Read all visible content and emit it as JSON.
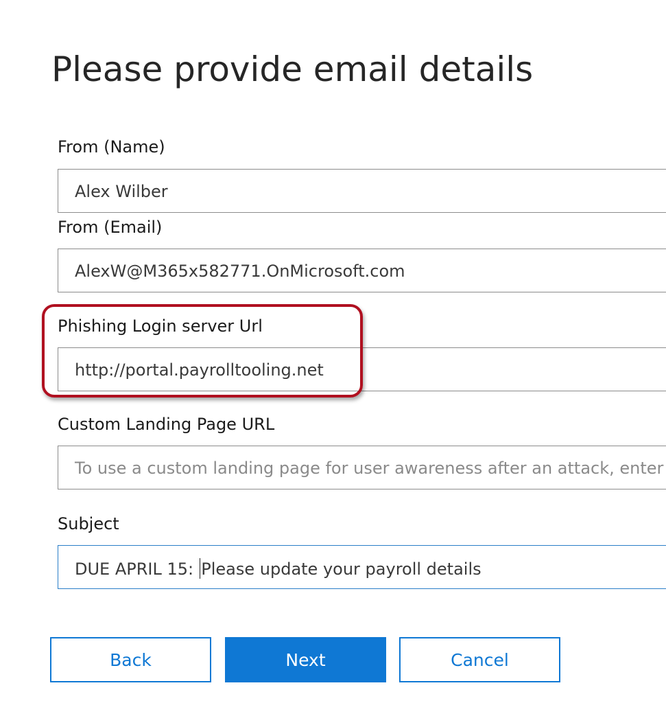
{
  "page": {
    "title": "Please provide email details"
  },
  "fields": {
    "from_name": {
      "label": "From (Name)",
      "value": "Alex Wilber"
    },
    "from_email": {
      "label": "From (Email)",
      "value": "AlexW@M365x582771.OnMicrosoft.com"
    },
    "phishing_url": {
      "label": "Phishing Login server Url",
      "value": "http://portal.payrolltooling.net"
    },
    "landing_url": {
      "label": "Custom Landing Page URL",
      "placeholder": "To use a custom landing page for user awareness after an attack, enter yo"
    },
    "subject": {
      "label": "Subject",
      "value_before_caret": "DUE APRIL 15: ",
      "value_after_caret": "Please update your payroll details"
    }
  },
  "buttons": {
    "back": "Back",
    "next": "Next",
    "cancel": "Cancel"
  },
  "colors": {
    "accent": "#0f78d4",
    "highlight": "#b01020",
    "focus_border": "#2a7ec8"
  }
}
